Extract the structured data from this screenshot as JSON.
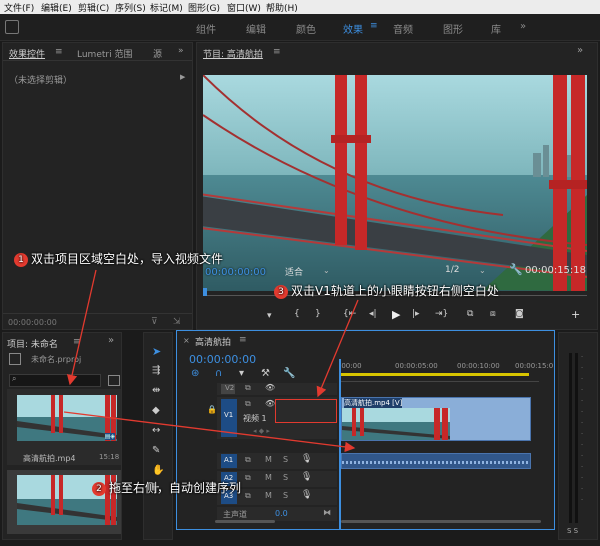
{
  "menu": [
    "文件(F)",
    "编辑(E)",
    "剪辑(C)",
    "序列(S)",
    "标记(M)",
    "图形(G)",
    "窗口(W)",
    "帮助(H)"
  ],
  "workspace_tabs": [
    "组件",
    "编辑",
    "颜色",
    "效果",
    "音频",
    "图形",
    "库"
  ],
  "workspace_active": "效果",
  "effect_controls": {
    "tab1": "效果控件",
    "tab2": "Lumetri 范围",
    "tab3": "源",
    "no_clip": "（未选择剪辑）",
    "timecode": "00:00:00:00"
  },
  "program": {
    "title": "节目: 高清航拍",
    "timecode": "00:00:00:00",
    "fit": "适合",
    "resolution": "1/2",
    "duration": "00:00:15:18"
  },
  "project": {
    "title": "项目: 未命名",
    "file": "未命名.prproj",
    "clips": [
      {
        "name": "高清航拍.mp4",
        "duration": "15:18"
      },
      {
        "name": "",
        "duration": ""
      }
    ]
  },
  "timeline": {
    "tab": "高清航拍",
    "timecode": "00:00:00:00",
    "ruler": [
      ":00:00",
      "00:00:05:00",
      "00:00:10:00",
      "00:00:15:0"
    ],
    "tracks": {
      "v2": "V2",
      "v1": "V1",
      "a1": "A1",
      "a2": "A2",
      "a3": "A3",
      "v1_label": "视频 1",
      "master": "主声道",
      "master_val": "0.0"
    },
    "clip_name": "高清航拍.mp4 [V]"
  },
  "callouts": [
    {
      "num": "1",
      "text": "双击项目区域空白处，导入视频文件"
    },
    {
      "num": "2",
      "text": "拖至右侧，自动创建序列"
    },
    {
      "num": "3",
      "text": "双击V1轨道上的小眼睛按钮右侧空白处"
    }
  ],
  "colors": {
    "accent": "#3d8fe0",
    "callout_badge": "#e23a2f",
    "arrow": "#e23a2f"
  }
}
